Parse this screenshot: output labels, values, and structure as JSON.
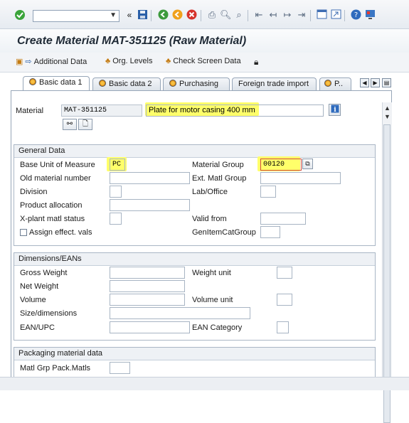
{
  "toolbar": {
    "command_field_value": "",
    "icons": [
      "check-icon",
      "back-double-icon",
      "save-icon",
      "back-icon",
      "exit-icon",
      "cancel-icon",
      "print-icon",
      "find-icon",
      "find-next-icon",
      "first-page-icon",
      "prev-page-icon",
      "next-page-icon",
      "last-page-icon",
      "new-session-icon",
      "shortcut-icon",
      "help-icon",
      "layout-icon"
    ]
  },
  "title": "Create Material MAT-351125 (Raw Material)",
  "app_toolbar": {
    "additional_data": "Additional Data",
    "org_levels": "Org. Levels",
    "check_screen_data": "Check Screen Data"
  },
  "tabs": [
    {
      "label": "Basic data 1",
      "active": true
    },
    {
      "label": "Basic data 2",
      "active": false
    },
    {
      "label": "Purchasing",
      "active": false
    },
    {
      "label": "Foreign trade import",
      "active": false
    },
    {
      "label": "P..",
      "active": false
    }
  ],
  "header": {
    "material_label": "Material",
    "material_value": "MAT-351125",
    "description_value": "Plate for motor casing 400 mm"
  },
  "general_data": {
    "title": "General Data",
    "base_uom_label": "Base Unit of Measure",
    "base_uom_value": "PC",
    "material_group_label": "Material Group",
    "material_group_value": "00120",
    "old_material_label": "Old material number",
    "ext_matl_group_label": "Ext. Matl Group",
    "division_label": "Division",
    "lab_office_label": "Lab/Office",
    "product_allocation_label": "Product allocation",
    "xplant_status_label": "X-plant matl status",
    "valid_from_label": "Valid from",
    "assign_effect_label": "Assign effect. vals",
    "gen_item_cat_label": "GenItemCatGroup"
  },
  "dimensions": {
    "title": "Dimensions/EANs",
    "gross_weight_label": "Gross Weight",
    "weight_unit_label": "Weight unit",
    "net_weight_label": "Net Weight",
    "volume_label": "Volume",
    "volume_unit_label": "Volume unit",
    "size_label": "Size/dimensions",
    "ean_label": "EAN/UPC",
    "ean_category_label": "EAN Category"
  },
  "packaging": {
    "title": "Packaging material data",
    "matl_grp_pack_label": "Matl Grp Pack.Matls"
  },
  "colors": {
    "highlight": "#ffff29",
    "panel_border": "#97a6b8",
    "title_text": "#1f2a36"
  }
}
